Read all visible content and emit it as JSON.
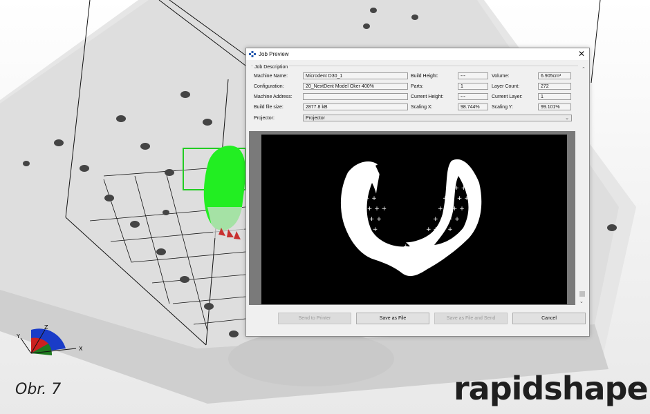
{
  "dialog": {
    "title": "Job Preview",
    "group_title": "Job Description",
    "fields": {
      "machine_name": {
        "label": "Machine Name:",
        "value": "Microdent D30_1"
      },
      "configuration": {
        "label": "Configuration:",
        "value": "20_NextDent Model Oker 400%"
      },
      "machine_address": {
        "label": "Machine Address:",
        "value": ""
      },
      "build_file_size": {
        "label": "Build file size:",
        "value": "2877.8 kB"
      },
      "projector": {
        "label": "Projector:",
        "value": "Projector"
      },
      "build_height": {
        "label": "Build Height:",
        "value": "---"
      },
      "parts": {
        "label": "Parts:",
        "value": "1"
      },
      "current_height": {
        "label": "Current Height:",
        "value": "---"
      },
      "scaling_x": {
        "label": "Scaling X:",
        "value": "98.744%"
      },
      "volume": {
        "label": "Volume:",
        "value": "6.905cm³"
      },
      "layer_count": {
        "label": "Layer Count:",
        "value": "272"
      },
      "current_layer": {
        "label": "Current Layer:",
        "value": "1"
      },
      "scaling_y": {
        "label": "Scaling Y:",
        "value": "99.101%"
      }
    },
    "buttons": {
      "send_to_printer": "Send to Printer",
      "save_as_file": "Save as File",
      "save_and_send": "Save as File and Send",
      "cancel": "Cancel"
    },
    "close_glyph": "✕",
    "scroll_up_glyph": "⌃",
    "scroll_down_glyph": "⌄",
    "dropdown_glyph": "⌄"
  },
  "caption": "Obr. 7",
  "brand": "rapidshape",
  "axis_labels": {
    "x": "X",
    "y": "Y",
    "z": "Z"
  },
  "colors": {
    "accent_green": "#22ee22",
    "brand_red": "#c8102e",
    "axis_blue": "#1a3cc8"
  }
}
